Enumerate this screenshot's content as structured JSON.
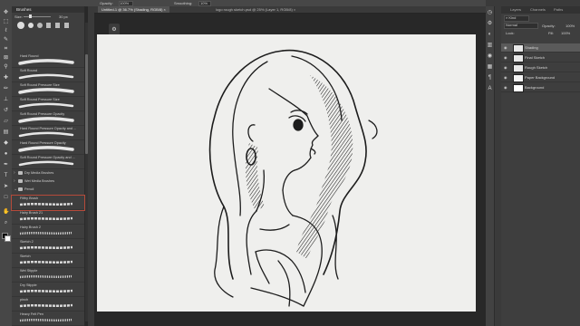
{
  "options_bar": {
    "items": [
      "Opacity:",
      "100%",
      "Smoothing:",
      "10%"
    ]
  },
  "tabs": [
    {
      "label": "Untitled-1 @ 36.7% (Shading, RGB/8)",
      "active": true
    },
    {
      "label": "logo rough sketch.psd @ 25% (Layer 1, RGB/8)",
      "active": false
    }
  ],
  "brushes_panel": {
    "tab_label": "Brushes",
    "size_label": "Size:",
    "size_value": "30 px",
    "brushes": [
      {
        "label": "Hard Round"
      },
      {
        "label": "Soft Round"
      },
      {
        "label": "Soft Round Pressure Size"
      },
      {
        "label": "Soft Round Pressure Size"
      },
      {
        "label": "Soft Round Pressure Opacity"
      },
      {
        "label": "Hard Round Pressure Opacity and ..."
      },
      {
        "label": "Hard Round Pressure Opacity"
      },
      {
        "label": "Soft Round Pressure Opacity and ..."
      }
    ],
    "folders": [
      {
        "label": "Dry Media Brushes"
      },
      {
        "label": "Wet Media Brushes"
      },
      {
        "label": "Pencil"
      }
    ],
    "pencil_brushes": [
      {
        "label": "Filthy Brush"
      },
      {
        "label": "Hairy Brush 21"
      },
      {
        "label": "Hairy Brush 2"
      },
      {
        "label": "Sketch 2"
      },
      {
        "label": "Sketch"
      },
      {
        "label": "Wet Stipple"
      },
      {
        "label": "Dry Stipple"
      },
      {
        "label": "pinch"
      },
      {
        "label": "Heavy Felt Pen"
      }
    ]
  },
  "layers_panel": {
    "tabs": [
      "Layers",
      "Channels",
      "Paths"
    ],
    "kind_label": "Kind",
    "blend_mode": "Normal",
    "opacity_label": "Opacity:",
    "opacity_value": "100%",
    "lock_label": "Lock:",
    "fill_label": "Fill:",
    "fill_value": "100%",
    "layers": [
      {
        "name": "Shading",
        "selected": true
      },
      {
        "name": "Final Sketch",
        "selected": false
      },
      {
        "name": "Rough Sketch",
        "selected": false
      },
      {
        "name": "Paper Background",
        "selected": false
      },
      {
        "name": "Background",
        "selected": false
      }
    ]
  },
  "icons": {
    "tools": [
      "move-icon",
      "marquee-icon",
      "lasso-icon",
      "quick-select-icon",
      "crop-icon",
      "frame-icon",
      "eyedropper-icon",
      "healing-icon",
      "brush-icon",
      "stamp-icon",
      "history-brush-icon",
      "eraser-icon",
      "gradient-icon",
      "blur-icon",
      "dodge-icon",
      "pen-icon",
      "type-icon",
      "path-select-icon",
      "rectangle-icon",
      "hand-icon",
      "zoom-icon"
    ]
  },
  "colors": {
    "panel": "#3e3e3e",
    "workspace": "#282828",
    "paper": "#efefed",
    "ink": "#1a1a1a",
    "selection": "#5a5a5a"
  }
}
